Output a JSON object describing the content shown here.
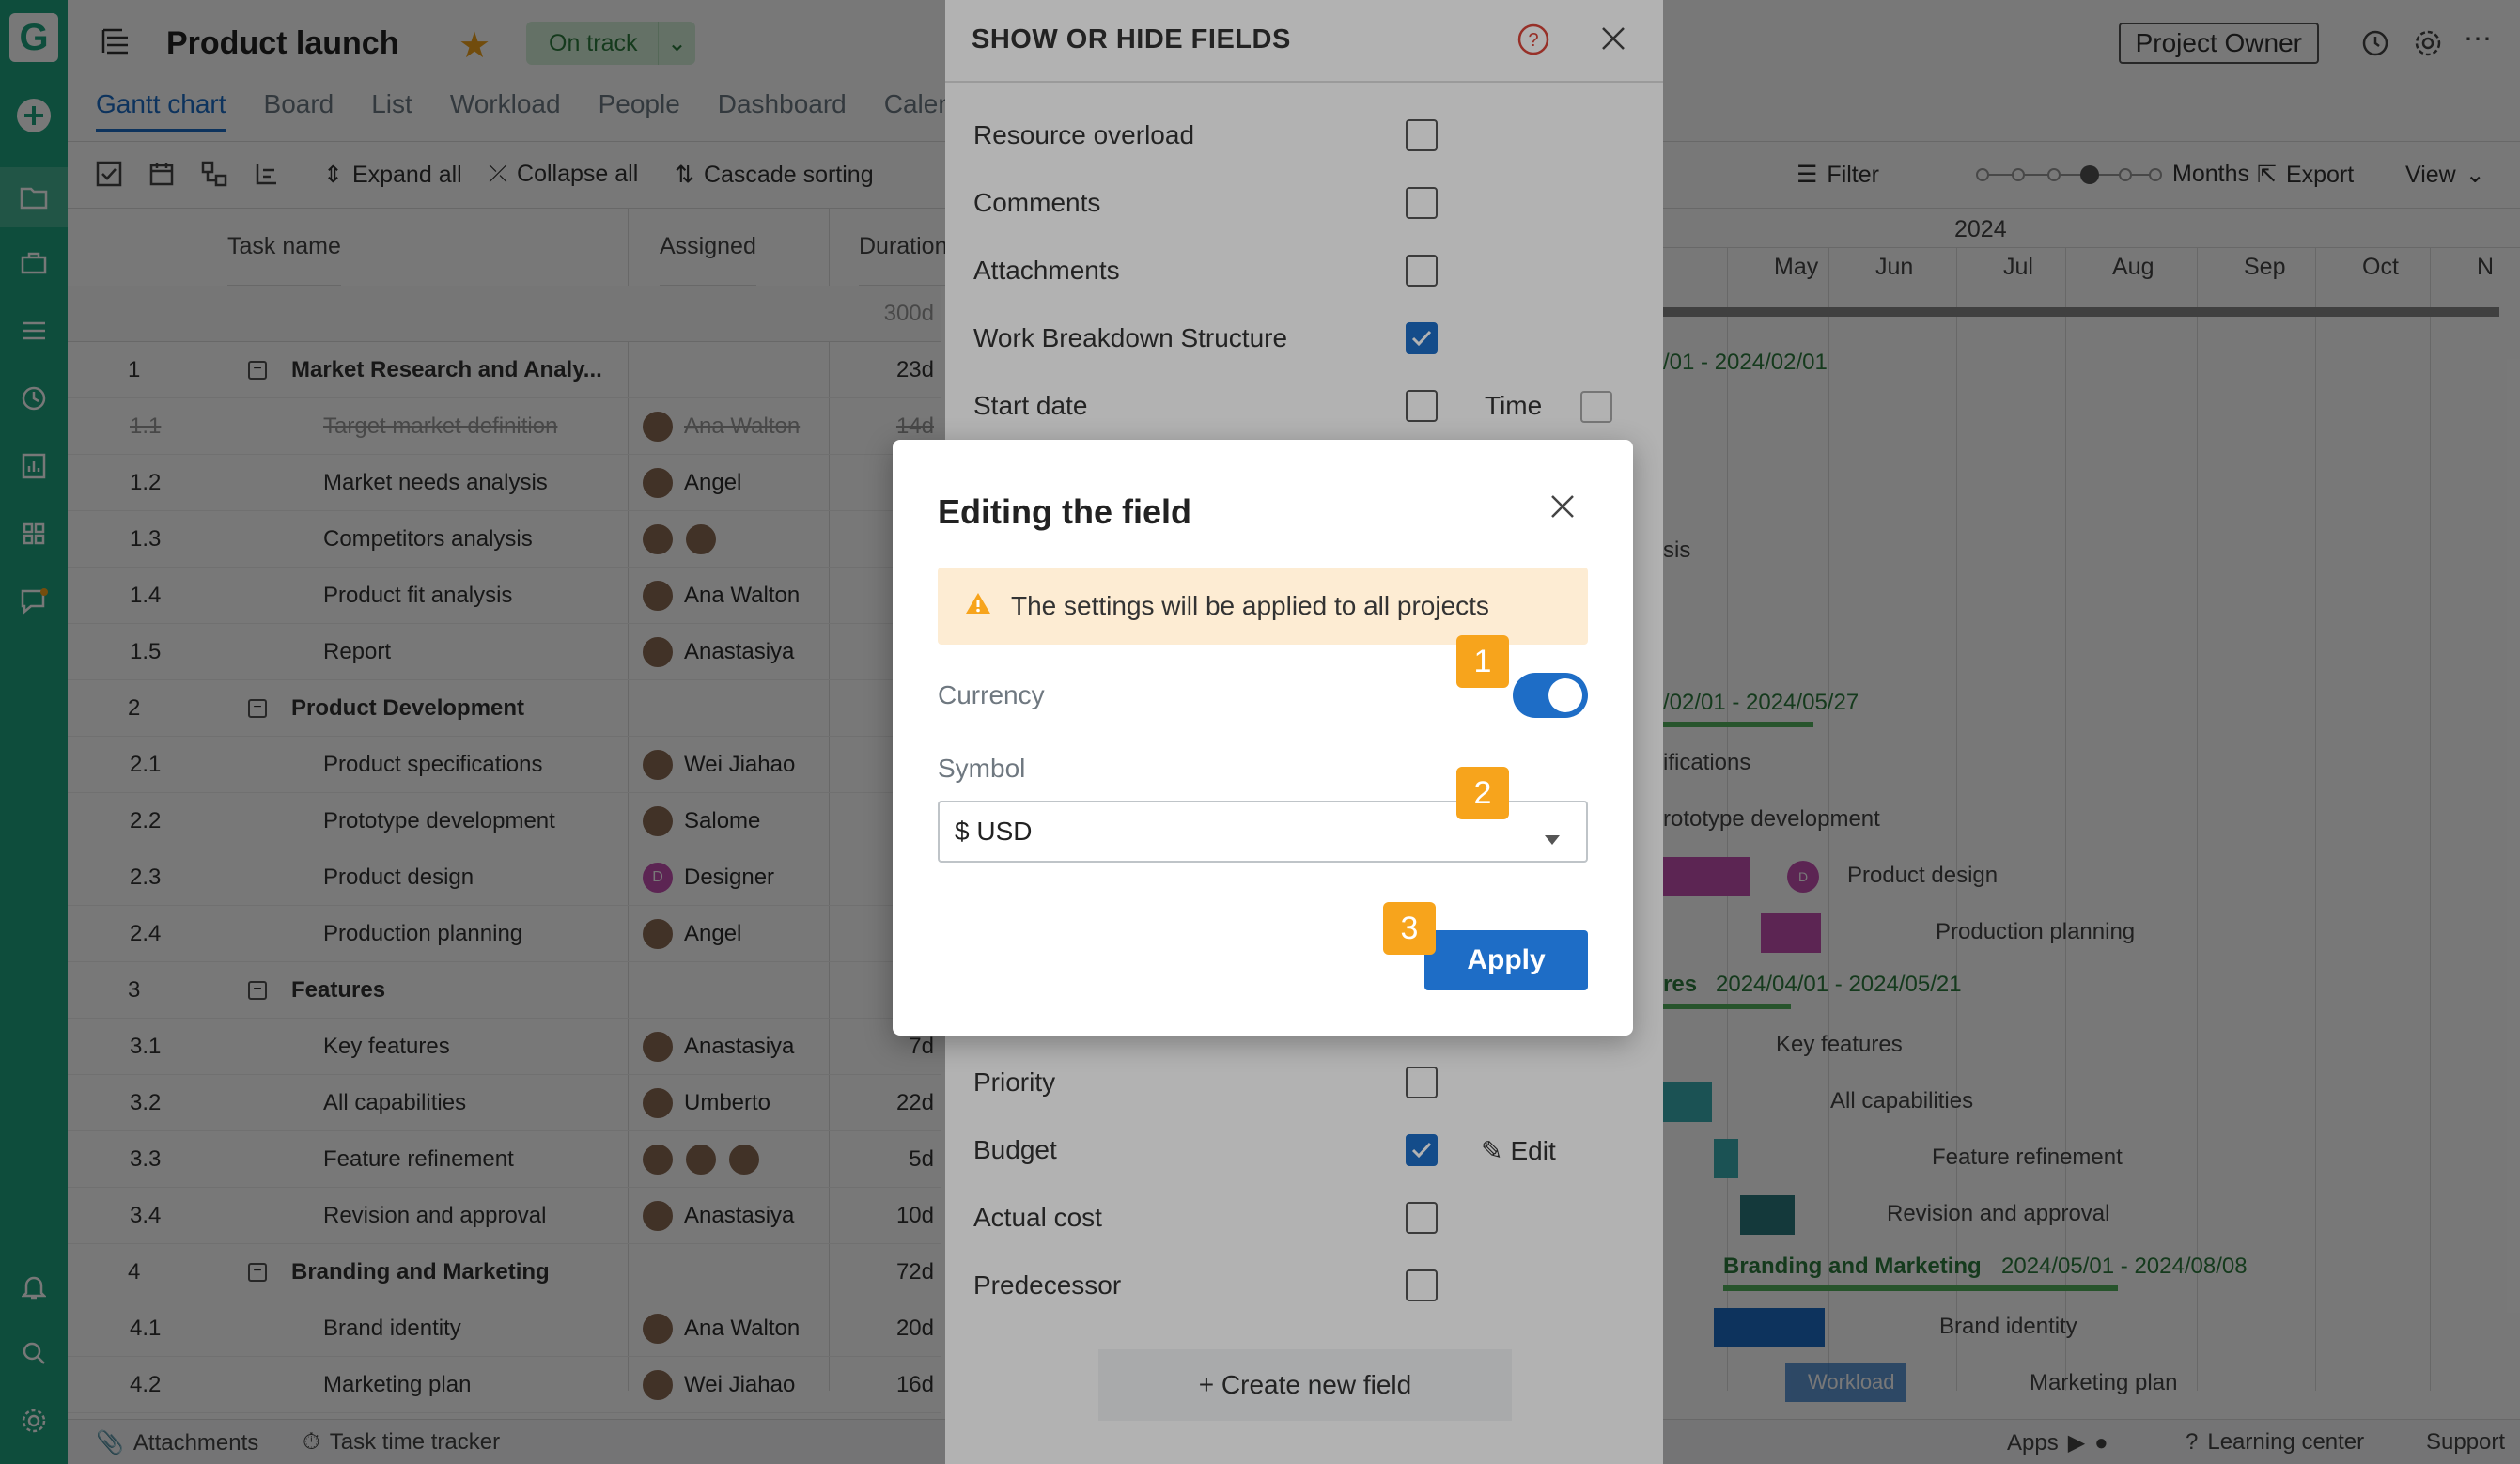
{
  "header": {
    "title": "Product launch",
    "status": "On track",
    "owner_button": "Project Owner"
  },
  "tabs": [
    "Gantt chart",
    "Board",
    "List",
    "Workload",
    "People",
    "Dashboard",
    "Calen"
  ],
  "toolbar": {
    "expand_all": "Expand all",
    "collapse_all": "Collapse all",
    "cascade_sorting": "Cascade sorting",
    "filter": "Filter",
    "zoom": "Months",
    "export": "Export",
    "view": "View"
  },
  "grid": {
    "col_task": "Task name",
    "col_assigned": "Assigned",
    "col_duration": "Duration",
    "total_duration": "300d",
    "rows": [
      {
        "num": "1",
        "name": "Market Research and Analy...",
        "assigned": "",
        "dur": "23d",
        "type": "group"
      },
      {
        "num": "1.1",
        "name": "Target market definition",
        "assigned": "Ana Walton",
        "dur": "14d",
        "type": "done"
      },
      {
        "num": "1.2",
        "name": "Market needs analysis",
        "assigned": "Angel",
        "dur": "",
        "type": "task"
      },
      {
        "num": "1.3",
        "name": "Competitors analysis",
        "assigned": "",
        "dur": "",
        "type": "task"
      },
      {
        "num": "1.4",
        "name": "Product fit analysis",
        "assigned": "Ana Walton",
        "dur": "",
        "type": "task"
      },
      {
        "num": "1.5",
        "name": "Report",
        "assigned": "Anastasiya",
        "dur": "",
        "type": "task"
      },
      {
        "num": "2",
        "name": "Product Development",
        "assigned": "",
        "dur": "",
        "type": "group"
      },
      {
        "num": "2.1",
        "name": "Product specifications",
        "assigned": "Wei Jiahao",
        "dur": "",
        "type": "task"
      },
      {
        "num": "2.2",
        "name": "Prototype development",
        "assigned": "Salome",
        "dur": "",
        "type": "task"
      },
      {
        "num": "2.3",
        "name": "Product design",
        "assigned": "Designer",
        "dur": "",
        "type": "task"
      },
      {
        "num": "2.4",
        "name": "Production planning",
        "assigned": "Angel",
        "dur": "",
        "type": "task"
      },
      {
        "num": "3",
        "name": "Features",
        "assigned": "",
        "dur": "",
        "type": "group"
      },
      {
        "num": "3.1",
        "name": "Key features",
        "assigned": "Anastasiya",
        "dur": "7d",
        "type": "task"
      },
      {
        "num": "3.2",
        "name": "All capabilities",
        "assigned": "Umberto",
        "dur": "22d",
        "type": "task"
      },
      {
        "num": "3.3",
        "name": "Feature refinement",
        "assigned": "",
        "dur": "5d",
        "type": "task"
      },
      {
        "num": "3.4",
        "name": "Revision and approval",
        "assigned": "Anastasiya",
        "dur": "10d",
        "type": "task"
      },
      {
        "num": "4",
        "name": "Branding and Marketing",
        "assigned": "",
        "dur": "72d",
        "type": "group"
      },
      {
        "num": "4.1",
        "name": "Brand identity",
        "assigned": "Ana Walton",
        "dur": "20d",
        "type": "task"
      },
      {
        "num": "4.2",
        "name": "Marketing plan",
        "assigned": "Wei Jiahao",
        "dur": "16d",
        "type": "task"
      }
    ]
  },
  "gantt": {
    "year": "2024",
    "months": [
      "May",
      "Jun",
      "Jul",
      "Aug",
      "Sep",
      "Oct",
      "N"
    ],
    "labels": {
      "l1": "/01 - 2024/02/01",
      "l2": "sis",
      "l3": "/02/01 - 2024/05/27",
      "l4": "ifications",
      "l5": "rototype development",
      "l6": "Product design",
      "l7": "Production planning",
      "l8_a": "res",
      "l8_b": "2024/04/01 - 2024/05/21",
      "l9": "Key features",
      "l10": "All capabilities",
      "l11": "Feature refinement",
      "l12": "Revision and approval",
      "l13_a": "Branding and Marketing",
      "l13_b": "2024/05/01 - 2024/08/08",
      "l14": "Brand identity",
      "l15": "Marketing plan",
      "workload": "Workload"
    }
  },
  "bottom": {
    "attachments": "Attachments",
    "time_tracker": "Task time tracker",
    "apps": "Apps",
    "learning": "Learning center",
    "support": "Support"
  },
  "panel": {
    "title": "SHOW OR HIDE FIELDS",
    "fields_top": [
      {
        "label": "Resource overload",
        "checked": false
      },
      {
        "label": "Comments",
        "checked": false
      },
      {
        "label": "Attachments",
        "checked": false
      },
      {
        "label": "Work Breakdown Structure",
        "checked": true
      },
      {
        "label": "Start date",
        "checked": false
      }
    ],
    "time_label": "Time",
    "fields_bottom": [
      {
        "label": "Priority",
        "checked": false
      },
      {
        "label": "Budget",
        "checked": true
      },
      {
        "label": "Actual cost",
        "checked": false
      },
      {
        "label": "Predecessor",
        "checked": false
      }
    ],
    "edit_label": "Edit",
    "create_field": "+ Create new field"
  },
  "modal": {
    "title": "Editing the field",
    "warning": "The settings will be applied to all projects",
    "currency_label": "Currency",
    "currency_enabled": true,
    "symbol_label": "Symbol",
    "symbol_value": "$ USD",
    "apply": "Apply",
    "steps": [
      "1",
      "2",
      "3"
    ]
  },
  "colors": {
    "sidebar": "#20a47f",
    "accent": "#1e6dc6",
    "step_badge": "#f7a41c",
    "warning_bg": "#fdecd3"
  }
}
